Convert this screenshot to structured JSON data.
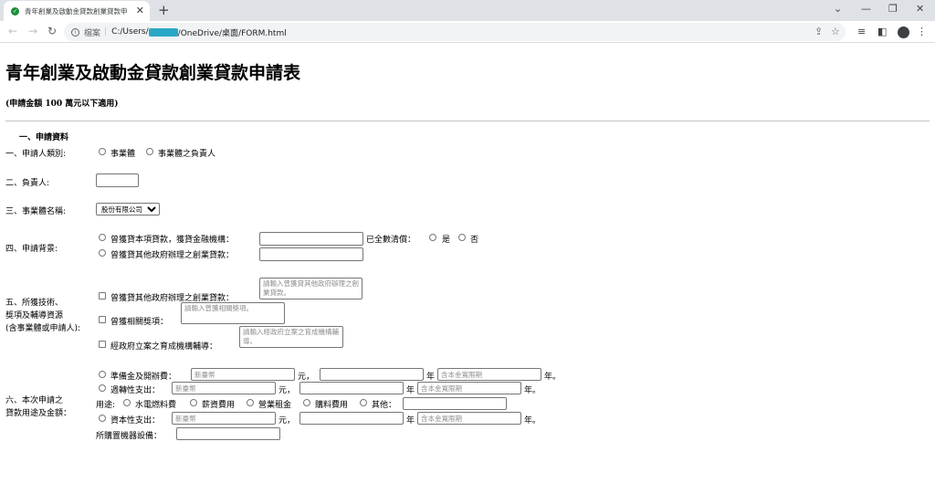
{
  "browser": {
    "tab_title": "青年創業及啟動金貸款創業貸款申",
    "new_tab": "+",
    "minimize": "⌄",
    "min_btn": "—",
    "max_btn": "❐",
    "close_btn": "✕",
    "address_label": "檔案",
    "address_path_1": "C:/Users/",
    "address_path_2": "/OneDrive/桌面/FORM.html"
  },
  "form": {
    "title": "青年創業及啟動金貸款創業貸款申請表",
    "subtitle": "(申請金額 100 萬元以下適用)",
    "section_title": "一、申請資料",
    "q1": {
      "label": "一、申請人類別:",
      "options": [
        "事業體",
        "事業體之負責人"
      ]
    },
    "q2": {
      "label": "二、負責人:",
      "value": ""
    },
    "q3": {
      "label": "三、事業體名稱:",
      "selected": "股份有限公司"
    },
    "q4": {
      "label": "四、申請背景:",
      "opt1": "曾獲貸本項貸款，獲貸金融機構：",
      "repaid_label": "已全數清償：",
      "repaid_yes": "是",
      "repaid_no": "否",
      "opt2": "曾獲貸其他政府辦理之創業貸款："
    },
    "q5": {
      "label_1": "五、所獲技術、",
      "label_2": "獎項及輔導資源",
      "label_3": "(含事業體或申請人):",
      "item1": "曾獲貸其他政府辦理之創業貸款：",
      "item1_placeholder": "請輸入曾獲貸其他政府辦理之創業貸款。",
      "item2": "曾獲相關獎項：",
      "item2_placeholder": "請輸入曾獲相關獎項。",
      "item3": "經政府立案之育成機構輔導：",
      "item3_placeholder": "請輸入經政府立案之育成機構輔導。"
    },
    "q6": {
      "label_1": "六、本次申請之",
      "label_2": "貸款用途及金額：",
      "prep": "準備金及開辦費：",
      "working": "週轉性支出：",
      "capital": "資本性支出：",
      "currency_placeholder": "新臺幣",
      "period_placeholder": "含本金寬限期",
      "yuan": "元，",
      "year": "年",
      "year_end": "年。",
      "usage_label": "用途:",
      "usage_options": [
        "水電燃料費",
        "薪資費用",
        "營業租金",
        "購料費用",
        "其他："
      ],
      "equipment_label": "所購置機器設備："
    }
  }
}
